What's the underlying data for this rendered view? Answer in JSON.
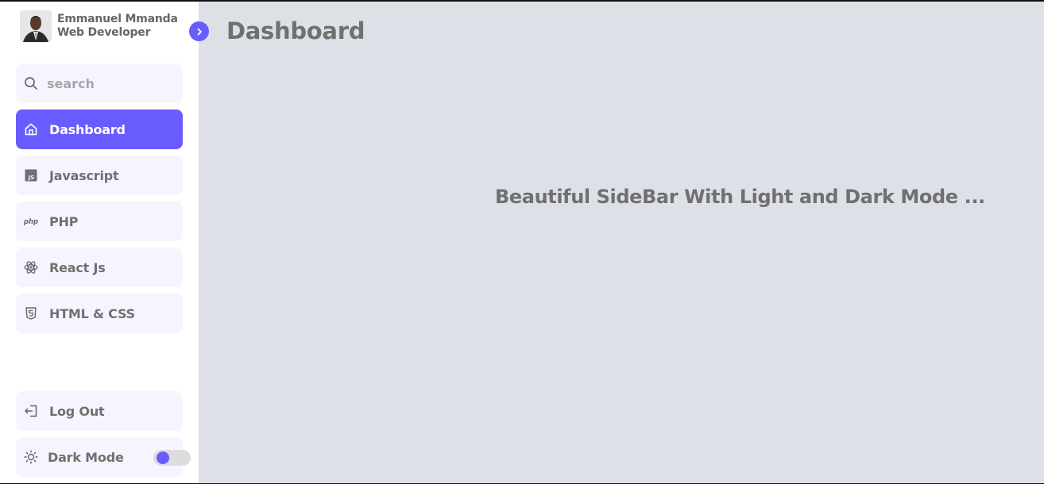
{
  "profile": {
    "name": "Emmanuel Mmanda",
    "role": "Web Developer"
  },
  "search": {
    "placeholder": "search",
    "value": ""
  },
  "menu": {
    "items": [
      {
        "label": "Dashboard",
        "icon": "home-icon",
        "active": true
      },
      {
        "label": "Javascript",
        "icon": "js-icon",
        "active": false
      },
      {
        "label": "PHP",
        "icon": "php-icon",
        "active": false
      },
      {
        "label": "React Js",
        "icon": "react-icon",
        "active": false
      },
      {
        "label": "HTML & CSS",
        "icon": "html5-icon",
        "active": false
      }
    ],
    "logout_label": "Log Out",
    "dark_mode_label": "Dark Mode",
    "dark_mode_on": false
  },
  "main": {
    "title": "Dashboard",
    "subtitle": "Beautiful SideBar With Light and Dark Mode ...",
    "php_icon_text": "php",
    "js_icon_text": "JS"
  },
  "colors": {
    "accent": "#695cfe",
    "sidebar_bg": "#ffffff",
    "menu_bg": "#f6f5ff",
    "page_bg": "#dde0e7",
    "text": "#707070"
  }
}
